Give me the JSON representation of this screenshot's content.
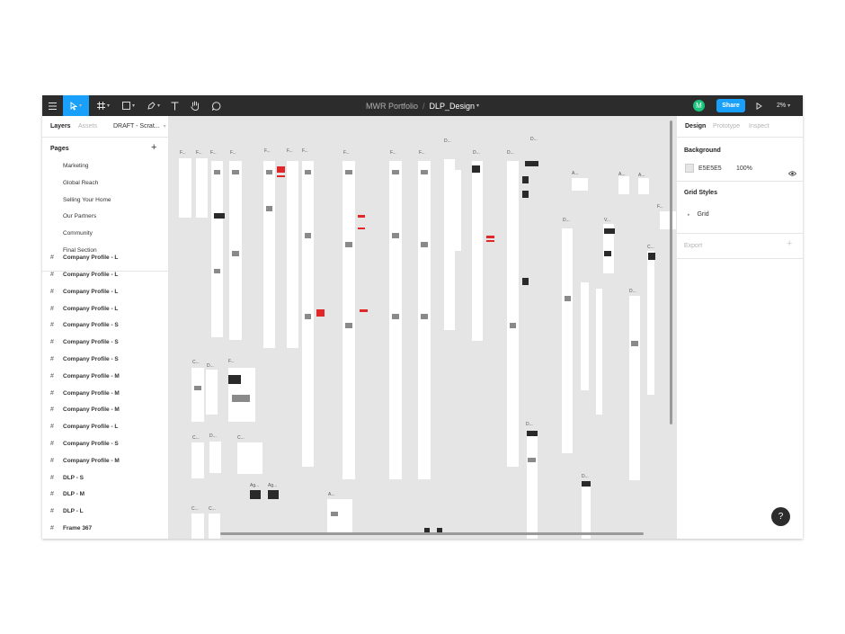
{
  "toolbar": {
    "project": "MWR Portfolio",
    "separator": "/",
    "file": "DLP_Design",
    "avatar": "M",
    "share": "Share",
    "zoom": "2%",
    "icons": [
      "menu-icon",
      "move-tool-icon",
      "frame-tool-icon",
      "shape-tool-icon",
      "pen-tool-icon",
      "text-tool-icon",
      "hand-tool-icon",
      "comment-tool-icon",
      "play-icon"
    ]
  },
  "left_panel": {
    "tabs": [
      "Layers",
      "Assets"
    ],
    "page_selector": "DRAFT - Scrat...",
    "pages_header": "Pages",
    "pages": [
      "Marketing",
      "Global Reach",
      "Selling Your Home",
      "Our Partners",
      "Community",
      "Final Section"
    ],
    "layers": [
      "Company Profile - L",
      "Company Profile - L",
      "Company Profile - L",
      "Company Profile - L",
      "Company Profile - S",
      "Company Profile - S",
      "Company Profile - S",
      "Company Profile - M",
      "Company Profile - M",
      "Company Profile - M",
      "Company Profile - L",
      "Company Profile - S",
      "Company Profile - M",
      "DLP - S",
      "DLP - M",
      "DLP - L",
      "Frame 367"
    ]
  },
  "canvas": {
    "frame_labels": [
      "F...",
      "C...",
      "D...",
      "A...",
      "V...",
      "Ag..."
    ]
  },
  "right_panel": {
    "tabs": [
      "Design",
      "Prototype",
      "Inspect"
    ],
    "background_header": "Background",
    "background_hex": "E5E5E5",
    "background_opacity": "100%",
    "grid_styles_header": "Grid Styles",
    "grid_item": "Grid",
    "export_header": "Export"
  },
  "help": "?",
  "colors": {
    "toolbar": "#2c2c2c",
    "accent": "#18a0fb",
    "avatar": "#1bc47d",
    "canvas": "#e5e5e5"
  }
}
